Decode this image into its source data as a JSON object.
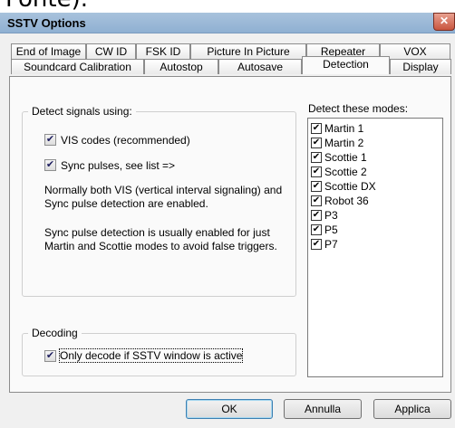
{
  "window": {
    "title": "SSTV Options",
    "close_label": "✕"
  },
  "top_clipped_text": "Fonte).",
  "tabs_row1": [
    "End of Image",
    "CW ID",
    "FSK ID",
    "Picture In Picture",
    "Repeater",
    "VOX"
  ],
  "tabs_row2": [
    "Soundcard Calibration",
    "Autostop",
    "Autosave",
    "Detection",
    "Display"
  ],
  "active_tab": "Detection",
  "detect_group": {
    "title": "Detect signals using:",
    "vis_label": "VIS codes (recommended)",
    "vis_checked": true,
    "sync_label": "Sync pulses, see list =>",
    "sync_checked": true,
    "note1": "Normally both VIS (vertical interval signaling) and Sync pulse detection are enabled.",
    "note2": "Sync pulse detection is usually enabled for just Martin and Scottie modes to avoid false triggers."
  },
  "decoding_group": {
    "title": "Decoding",
    "only_decode_label": "Only decode if SSTV window is active",
    "only_decode_checked": true
  },
  "modes": {
    "label": "Detect these modes:",
    "items": [
      {
        "label": "Martin 1",
        "checked": true
      },
      {
        "label": "Martin 2",
        "checked": true
      },
      {
        "label": "Scottie 1",
        "checked": true
      },
      {
        "label": "Scottie 2",
        "checked": true
      },
      {
        "label": "Scottie DX",
        "checked": true
      },
      {
        "label": "Robot 36",
        "checked": true
      },
      {
        "label": "P3",
        "checked": true
      },
      {
        "label": "P5",
        "checked": true
      },
      {
        "label": "P7",
        "checked": true
      }
    ]
  },
  "buttons": {
    "ok": "OK",
    "cancel": "Annulla",
    "apply": "Applica"
  },
  "colors": {
    "titlebar": "#a8c2dc",
    "close": "#c9553e",
    "dialog_bg": "#f0f0f0",
    "check_mark": "#202060"
  }
}
